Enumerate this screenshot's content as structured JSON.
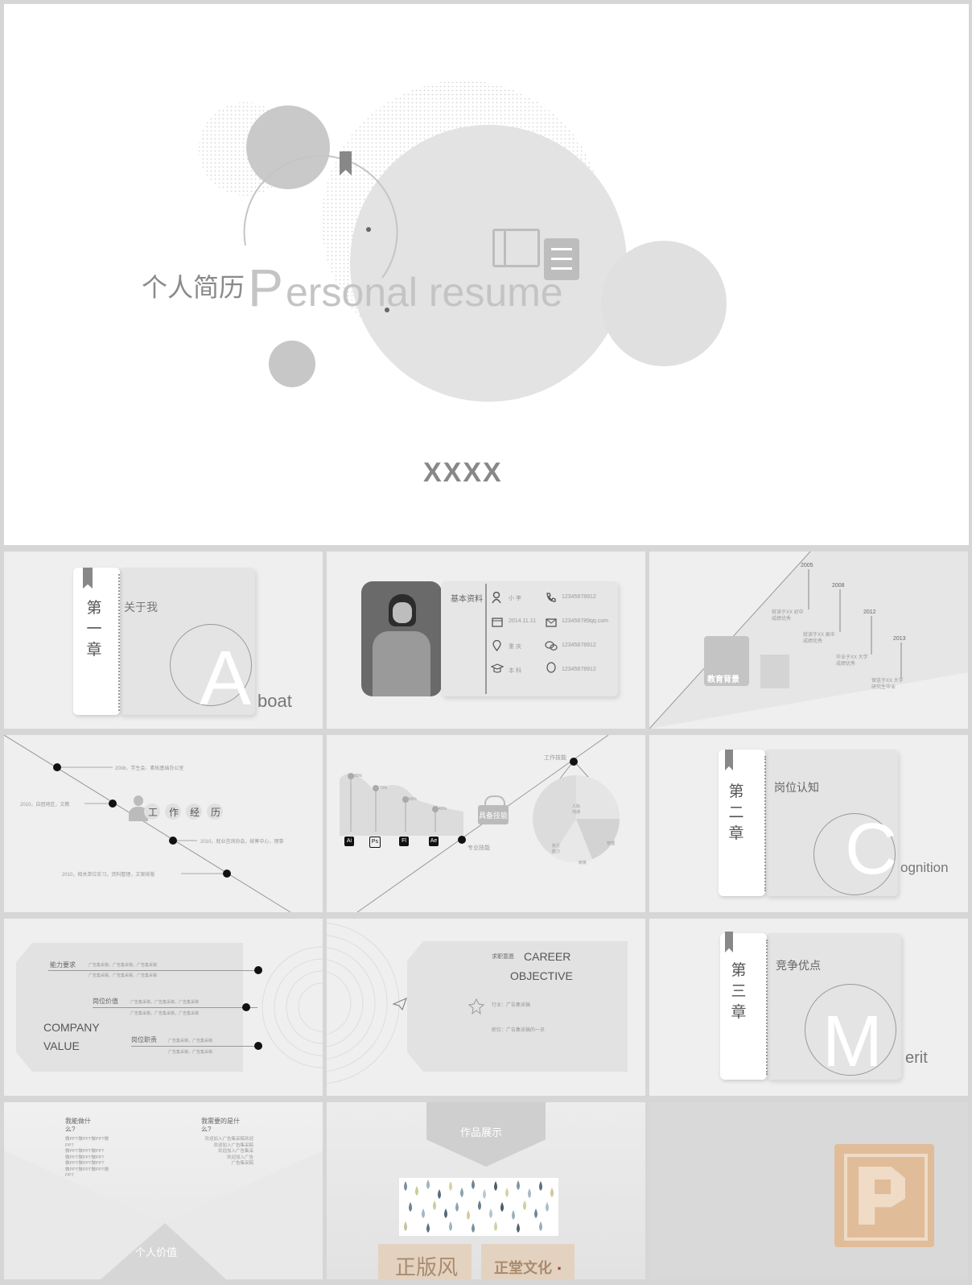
{
  "cover": {
    "title_cn": "个人简历",
    "title_en_initial": "P",
    "title_en_rest": "ersonal resume",
    "author": "XXXX",
    "icon": "document-icon"
  },
  "slide_about": {
    "chapter": [
      "第",
      "一",
      "章"
    ],
    "heading": "关于我",
    "big_letter": "A",
    "word_rest": "boat"
  },
  "slide_profile": {
    "section": "基本资料",
    "rows": [
      {
        "icon": "user-icon",
        "left": "小 李",
        "right_icon": "phone-icon",
        "right": "12345678912"
      },
      {
        "icon": "calendar-icon",
        "left": "2014.11.11",
        "right_icon": "mail-icon",
        "right": "123456789qq.com"
      },
      {
        "icon": "location-icon",
        "left": "重 庆",
        "right_icon": "wechat-icon",
        "right": "12345678912"
      },
      {
        "icon": "graduation-cap-icon",
        "left": "本 科",
        "right_icon": "qq-icon",
        "right": "12345678912"
      }
    ]
  },
  "slide_education": {
    "label": "教育背景",
    "years": [
      "2005",
      "2008",
      "2012",
      "2013"
    ],
    "entries": [
      [
        "就读于XX 初中",
        "成绩优秀"
      ],
      [
        "就读于XX 高中",
        "成绩优秀"
      ],
      [
        "毕业于XX 大学",
        "成绩优秀"
      ],
      [
        "保送于XX 大学",
        "研究生毕业"
      ]
    ]
  },
  "slide_work": {
    "chars": [
      "工",
      "作",
      "经",
      "历"
    ],
    "items": [
      "2008，学生会、素拓基础办公室",
      "2010，自团地区，文教",
      "2010，就业咨询协会，统筹中心，理事",
      "2010，相关单位实习，资料整理，文案排版"
    ]
  },
  "slide_skills": {
    "pin_labels": [
      "80%",
      "70%",
      "60%",
      "40%"
    ],
    "tools": [
      "Ai",
      "Ps",
      "Fl",
      "Ae"
    ],
    "badge": "具备技能",
    "work_skill": "工作技能",
    "pro_skill": "专业技能",
    "pie_labels": [
      "人际\n沟通",
      "管理",
      "统筹",
      "执行\n能力"
    ]
  },
  "slide_cognition": {
    "chapter": [
      "第",
      "二",
      "章"
    ],
    "heading": "岗位认知",
    "big_letter": "C",
    "word_rest": "ognition"
  },
  "slide_value": {
    "title": [
      "COMPANY",
      "VALUE"
    ],
    "rows": [
      {
        "label": "能力要求",
        "lines": [
          "广告集采稿，广告集采稿，广告集采稿",
          "广告集采稿，广告集采稿，广告集采稿"
        ]
      },
      {
        "label": "岗位价值",
        "lines": [
          "广告集采稿，广告集采稿，广告集采稿",
          "广告集采稿，广告集采稿，广告集采稿"
        ]
      },
      {
        "label": "岗位职责",
        "lines": [
          "广告集采稿，广告集采稿",
          "广告集采稿，广告集采稿"
        ]
      }
    ]
  },
  "slide_career": {
    "small": "求职意愿",
    "title1": "CAREER",
    "title2": "OBJECTIVE",
    "line1": "行业：广告集采稿",
    "line2": "职位：广告集采稿的一员"
  },
  "slide_merit": {
    "chapter": [
      "第",
      "三",
      "章"
    ],
    "heading": "竞争优点",
    "big_letter": "M",
    "word_rest": "erit"
  },
  "slide_personal": {
    "left_q": [
      "我能做什",
      "么?"
    ],
    "left_body": [
      "做PPT做PPT做PPT做",
      "PPT",
      "做PPT做PPT做PPT",
      "做PPT做PPT做PPT",
      "做PPT做PPT做PPT",
      "做PPT做PPT做PPT做",
      "PPT"
    ],
    "right_q": [
      "我需要的是什",
      "么?"
    ],
    "right_body": [
      "欢迎加入广告集采稿欢迎",
      "欢迎加入广告集采稿",
      "欢迎加入广告集采",
      "欢迎加入广告",
      "广告集采稿"
    ],
    "bottom": "个人价值"
  },
  "slide_works": {
    "banner": "作品展示",
    "logo1": "正版风",
    "logo2": "正堂文化",
    "logo2_dot": "."
  },
  "slide_logo": {
    "stamp_icon": "p-stamp-icon"
  }
}
